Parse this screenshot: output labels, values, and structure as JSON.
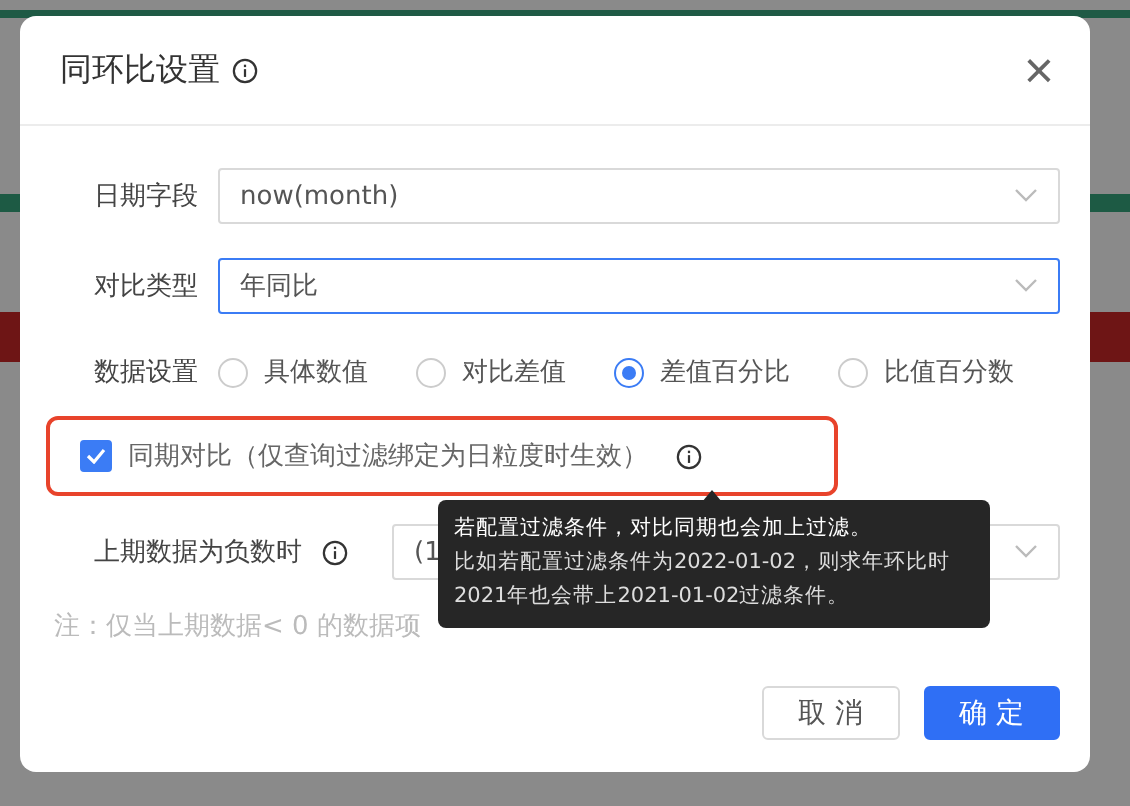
{
  "dialog": {
    "title": "同环比设置",
    "close": "×"
  },
  "fields": [
    {
      "label": "日期字段",
      "value": "now(month)",
      "focused": false
    },
    {
      "label": "对比类型",
      "value": "年同比",
      "focused": true
    }
  ],
  "data_setting": {
    "label": "数据设置",
    "options": [
      {
        "label": "具体数值",
        "selected": false
      },
      {
        "label": "对比差值",
        "selected": false
      },
      {
        "label": "差值百分比",
        "selected": true
      },
      {
        "label": "比值百分数",
        "selected": false
      }
    ]
  },
  "same_period": {
    "label": "同期对比（仅查询过滤绑定为日粒度时生效）",
    "checked": true,
    "highlighted": true
  },
  "negative": {
    "label": "上期数据为负数时",
    "value": "(1"
  },
  "note": "注：仅当上期数据< 0 的数据项",
  "tooltip": {
    "title": "若配置过滤条件，对比同期也会加上过滤。",
    "body": "比如若配置过滤条件为2022-01-02，则求年环比时2021年也会带上2021-01-02过滤条件。"
  },
  "buttons": [
    {
      "label": "取 消",
      "kind": "default"
    },
    {
      "label": "确 定",
      "kind": "primary"
    }
  ]
}
